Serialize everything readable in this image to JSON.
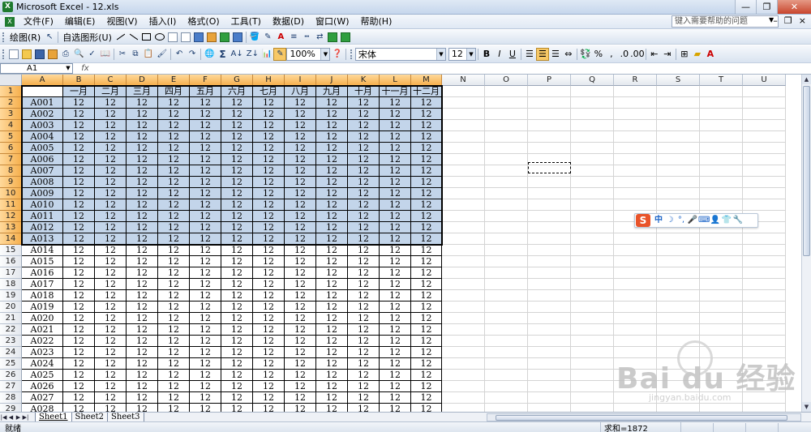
{
  "window": {
    "title": "Microsoft Excel - 12.xls",
    "app_icon": "X",
    "buttons": {
      "minimize": "—",
      "restore": "❐",
      "close": "✕"
    }
  },
  "menubar": {
    "items": [
      "文件(F)",
      "编辑(E)",
      "视图(V)",
      "插入(I)",
      "格式(O)",
      "工具(T)",
      "数据(D)",
      "窗口(W)",
      "帮助(H)"
    ],
    "help_placeholder": "键入需要帮助的问题",
    "doc_buttons": {
      "minimize": "–",
      "restore": "❐",
      "close": "×"
    }
  },
  "drawbar": {
    "draw_label": "绘图(R)",
    "autoshape_label": "自选图形(U)"
  },
  "stdbar": {
    "zoom": "100%",
    "font_name": "宋体",
    "font_size": "12",
    "bold": "B",
    "italic": "I",
    "underline": "U",
    "percent": "%",
    "comma": ",",
    "sigma": "Σ",
    "font_color_label": "A"
  },
  "formula_bar": {
    "name_box": "A1",
    "fx": "fx",
    "content": ""
  },
  "sheet": {
    "columns": [
      "A",
      "B",
      "C",
      "D",
      "E",
      "F",
      "G",
      "H",
      "I",
      "J",
      "K",
      "L",
      "M",
      "N",
      "O",
      "P",
      "Q",
      "R",
      "S",
      "T",
      "U"
    ],
    "row_numbers": [
      "1",
      "2",
      "3",
      "4",
      "5",
      "6",
      "7",
      "8",
      "9",
      "10",
      "11",
      "12",
      "13",
      "14",
      "15",
      "16",
      "17",
      "18",
      "19",
      "20",
      "21",
      "22",
      "23",
      "24",
      "25",
      "26",
      "27",
      "28",
      "29"
    ],
    "header_row": [
      "",
      "一月",
      "二月",
      "三月",
      "四月",
      "五月",
      "六月",
      "七月",
      "八月",
      "九月",
      "十月",
      "十一月",
      "十二月"
    ],
    "row_ids": [
      "A001",
      "A002",
      "A003",
      "A004",
      "A005",
      "A006",
      "A007",
      "A008",
      "A009",
      "A010",
      "A011",
      "A012",
      "A013",
      "A014",
      "A015",
      "A016",
      "A017",
      "A018",
      "A019",
      "A020",
      "A021",
      "A022",
      "A023",
      "A024",
      "A025",
      "A026",
      "A027",
      "A028"
    ],
    "cell_value": "12"
  },
  "tabs": {
    "nav": [
      "|◀",
      "◀",
      "▶",
      "▶|"
    ],
    "sheets": [
      "Sheet1",
      "Sheet2",
      "Sheet3"
    ],
    "active": "Sheet1"
  },
  "status": {
    "mode": "就绪",
    "sum": "求和=1872"
  },
  "ime": {
    "logo": "S",
    "items": [
      "中",
      "☽",
      "°,",
      "🎤",
      "⌨",
      "👤",
      "👕",
      "🔧"
    ]
  },
  "watermark": {
    "brand": "Bai du 经验",
    "url": "jingyan.baidu.com"
  }
}
